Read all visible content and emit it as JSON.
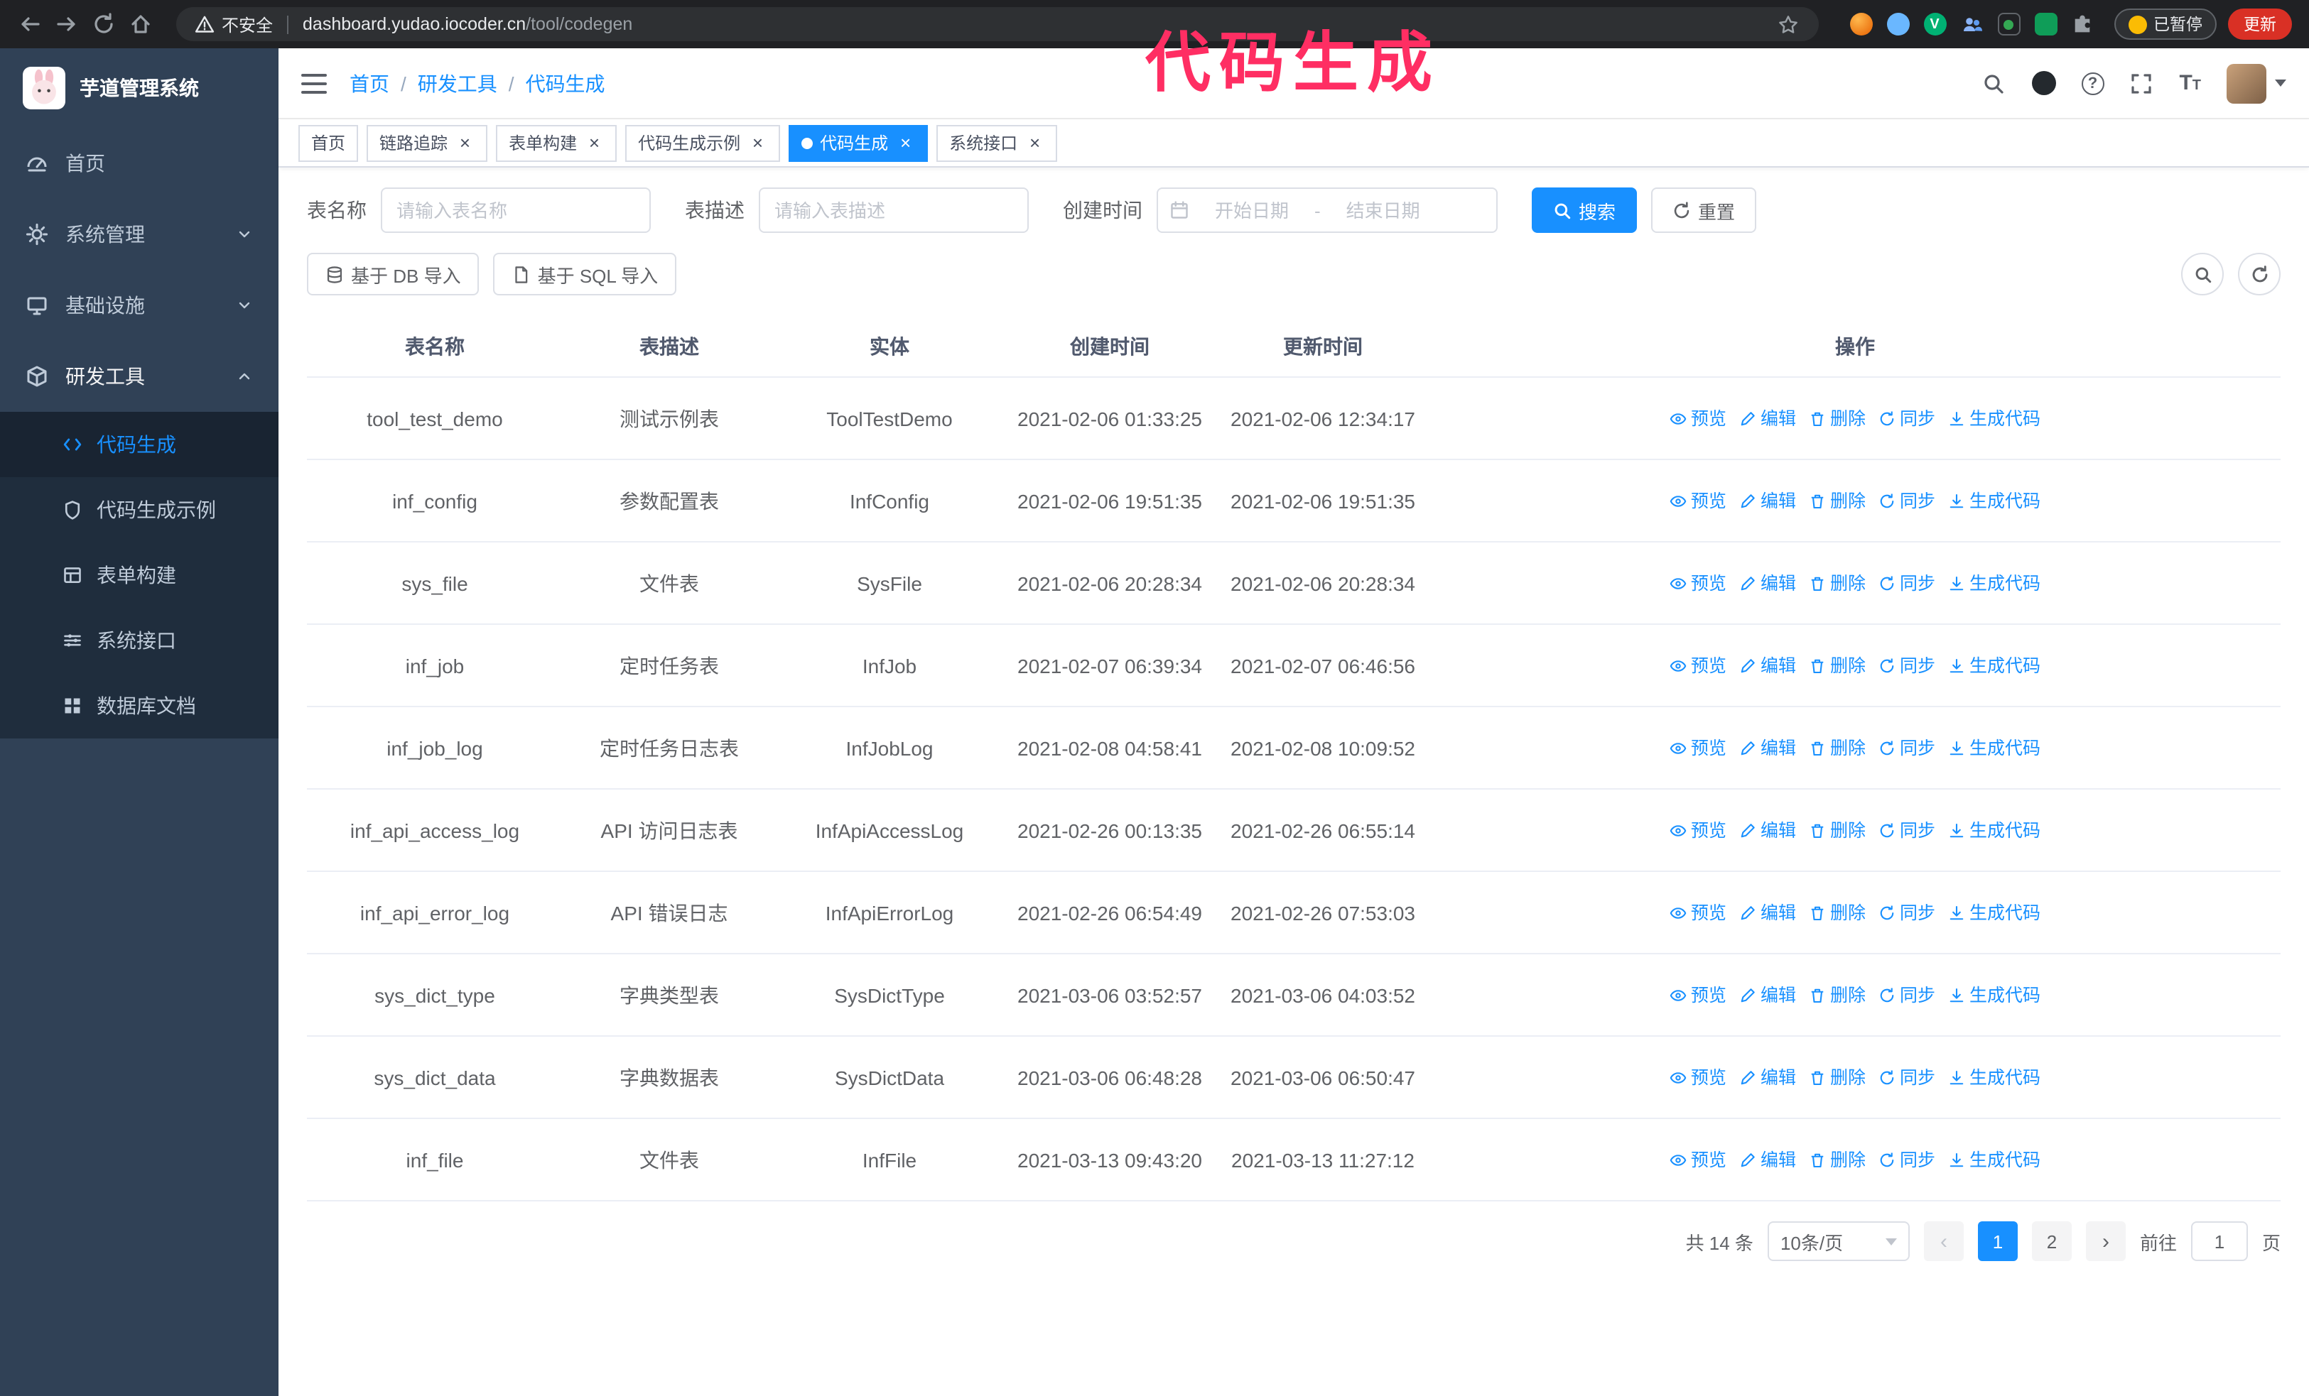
{
  "annotation": {
    "text": "代码生成",
    "color": "#ff2e63"
  },
  "colors": {
    "primary": "#1890ff",
    "sidebar_bg": "#304156",
    "submenu_bg": "#1f2d3d"
  },
  "browser": {
    "security_label": "不安全",
    "url_domain": "dashboard.yudao.iocoder.cn",
    "url_path": "/tool/codegen",
    "paused_badge": "已暂停",
    "update_button": "更新"
  },
  "sidebar": {
    "logo_title": "芋道管理系统",
    "items": [
      {
        "label": "首页",
        "expandable": false
      },
      {
        "label": "系统管理",
        "expandable": true
      },
      {
        "label": "基础设施",
        "expandable": true
      },
      {
        "label": "研发工具",
        "expandable": true,
        "expanded": true
      }
    ],
    "subitems": [
      "代码生成",
      "代码生成示例",
      "表单构建",
      "系统接口",
      "数据库文档"
    ],
    "active_subitem": "代码生成"
  },
  "navbar": {
    "breadcrumb": [
      "首页",
      "研发工具",
      "代码生成"
    ],
    "separator": "/"
  },
  "tabs": [
    {
      "label": "首页",
      "closable": false,
      "active": false
    },
    {
      "label": "链路追踪",
      "closable": true,
      "active": false
    },
    {
      "label": "表单构建",
      "closable": true,
      "active": false
    },
    {
      "label": "代码生成示例",
      "closable": true,
      "active": false
    },
    {
      "label": "代码生成",
      "closable": true,
      "active": true
    },
    {
      "label": "系统接口",
      "closable": true,
      "active": false
    }
  ],
  "filters": {
    "table_name_label": "表名称",
    "table_name_placeholder": "请输入表名称",
    "table_desc_label": "表描述",
    "table_desc_placeholder": "请输入表描述",
    "create_time_label": "创建时间",
    "date_start_placeholder": "开始日期",
    "date_separator": "-",
    "date_end_placeholder": "结束日期",
    "search_button": "搜索",
    "reset_button": "重置"
  },
  "toolbar": {
    "import_db": "基于 DB 导入",
    "import_sql": "基于 SQL 导入"
  },
  "table": {
    "columns": [
      "表名称",
      "表描述",
      "实体",
      "创建时间",
      "更新时间",
      "操作"
    ],
    "actions": [
      "预览",
      "编辑",
      "删除",
      "同步",
      "生成代码"
    ],
    "rows": [
      {
        "name": "tool_test_demo",
        "desc": "测试示例表",
        "entity": "ToolTestDemo",
        "created": "2021-02-06 01:33:25",
        "updated": "2021-02-06 12:34:17"
      },
      {
        "name": "inf_config",
        "desc": "参数配置表",
        "entity": "InfConfig",
        "created": "2021-02-06 19:51:35",
        "updated": "2021-02-06 19:51:35"
      },
      {
        "name": "sys_file",
        "desc": "文件表",
        "entity": "SysFile",
        "created": "2021-02-06 20:28:34",
        "updated": "2021-02-06 20:28:34"
      },
      {
        "name": "inf_job",
        "desc": "定时任务表",
        "entity": "InfJob",
        "created": "2021-02-07 06:39:34",
        "updated": "2021-02-07 06:46:56"
      },
      {
        "name": "inf_job_log",
        "desc": "定时任务日志表",
        "entity": "InfJobLog",
        "created": "2021-02-08 04:58:41",
        "updated": "2021-02-08 10:09:52"
      },
      {
        "name": "inf_api_access_log",
        "desc": "API 访问日志表",
        "entity": "InfApiAccessLog",
        "created": "2021-02-26 00:13:35",
        "updated": "2021-02-26 06:55:14"
      },
      {
        "name": "inf_api_error_log",
        "desc": "API 错误日志",
        "entity": "InfApiErrorLog",
        "created": "2021-02-26 06:54:49",
        "updated": "2021-02-26 07:53:03"
      },
      {
        "name": "sys_dict_type",
        "desc": "字典类型表",
        "entity": "SysDictType",
        "created": "2021-03-06 03:52:57",
        "updated": "2021-03-06 04:03:52"
      },
      {
        "name": "sys_dict_data",
        "desc": "字典数据表",
        "entity": "SysDictData",
        "created": "2021-03-06 06:48:28",
        "updated": "2021-03-06 06:50:47"
      },
      {
        "name": "inf_file",
        "desc": "文件表",
        "entity": "InfFile",
        "created": "2021-03-13 09:43:20",
        "updated": "2021-03-13 11:27:12"
      }
    ]
  },
  "pagination": {
    "total": "共 14 条",
    "page_size": "10条/页",
    "pages": [
      "1",
      "2"
    ],
    "active_page": "1",
    "goto_label": "前往",
    "goto_value": "1",
    "goto_suffix": "页"
  }
}
